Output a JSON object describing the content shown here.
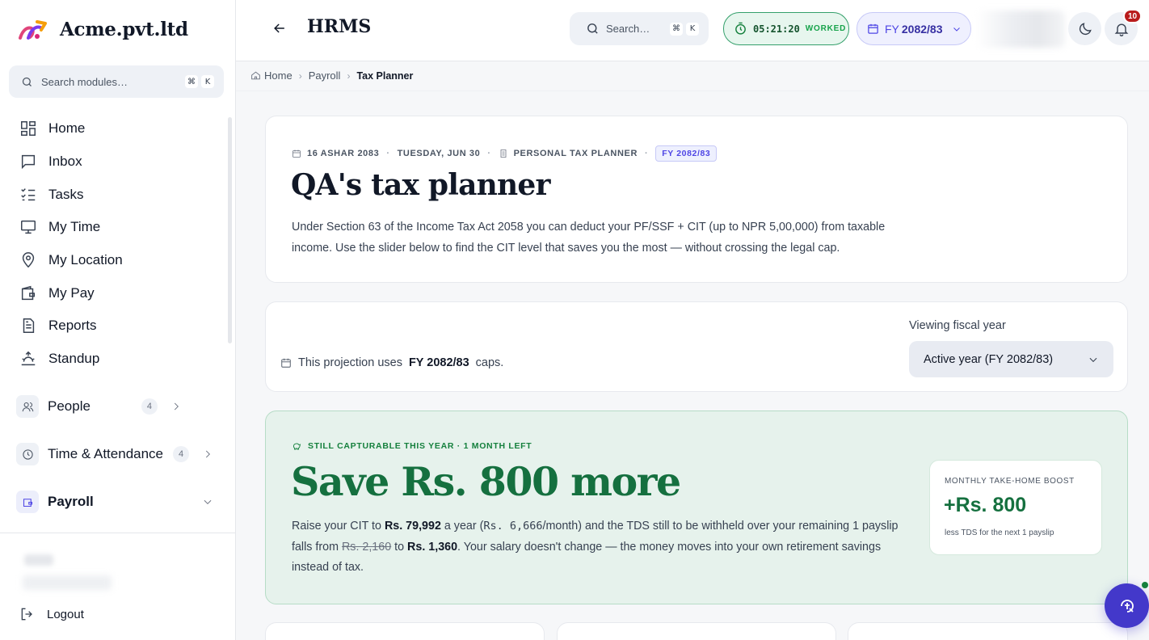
{
  "brand": {
    "name": "Acme.pvt.ltd"
  },
  "sidebar": {
    "search_placeholder": "Search modules…",
    "shortcut": [
      "⌘",
      "K"
    ],
    "items": [
      {
        "label": "Home",
        "icon": "grid-icon"
      },
      {
        "label": "Inbox",
        "icon": "message-icon"
      },
      {
        "label": "Tasks",
        "icon": "checklist-icon"
      },
      {
        "label": "My Time",
        "icon": "monitor-icon"
      },
      {
        "label": "My Location",
        "icon": "location-pin-icon"
      },
      {
        "label": "My Pay",
        "icon": "wallet-icon"
      },
      {
        "label": "Reports",
        "icon": "document-icon"
      },
      {
        "label": "Standup",
        "icon": "sunrise-icon"
      }
    ],
    "groups": [
      {
        "label": "People",
        "count": "4",
        "icon": "users-icon"
      },
      {
        "label": "Time & Attendance",
        "count": "4",
        "icon": "clock-icon"
      },
      {
        "label": "Payroll",
        "icon": "wallet-icon"
      }
    ],
    "logout_label": "Logout"
  },
  "header": {
    "title": "HRMS",
    "search_placeholder": "Search…",
    "shortcut": [
      "⌘",
      "K"
    ],
    "timer": {
      "value": "05:21:20",
      "label": "WORKED"
    },
    "fiscal_year": {
      "prefix": "FY",
      "value": "2082/83"
    },
    "notifications_count": "10"
  },
  "breadcrumb": [
    "Home",
    "Payroll",
    "Tax Planner"
  ],
  "planner": {
    "meta": {
      "nepali_date": "16 ASHAR 2083",
      "weekday_date": "TUESDAY, JUN 30",
      "section": "PERSONAL TAX PLANNER",
      "fy_chip": "FY 2082/83"
    },
    "title": "QA's tax planner",
    "intro": "Under Section 63 of the Income Tax Act 2058 you can deduct your PF/SSF + CIT (up to NPR 5,00,000) from taxable income. Use the slider below to find the CIT level that saves you the most — without crossing the legal cap."
  },
  "projection": {
    "note_prefix": "This projection uses",
    "note_fy": "FY 2082/83",
    "note_suffix": "caps.",
    "select_label": "Viewing fiscal year",
    "select_value": "Active year (FY 2082/83)"
  },
  "savings": {
    "kicker": "STILL CAPTURABLE THIS YEAR · 1 MONTH LEFT",
    "headline": "Save Rs. 800 more",
    "desc": {
      "t1": "Raise your CIT to ",
      "cit_year": "Rs. 79,992",
      "t2": " a year (",
      "cit_month": "Rs. 6,666",
      "t3": "/month) and the TDS still to be withheld over your remaining 1 payslip falls from ",
      "tds_old": "Rs. 2,160",
      "t4": " to ",
      "tds_new": "Rs. 1,360",
      "t5": ". Your salary doesn't change — the money moves into your own retirement savings instead of tax."
    },
    "boost": {
      "label": "MONTHLY TAKE-HOME BOOST",
      "value": "+Rs. 800",
      "sub": "less TDS for the next 1 payslip"
    }
  }
}
